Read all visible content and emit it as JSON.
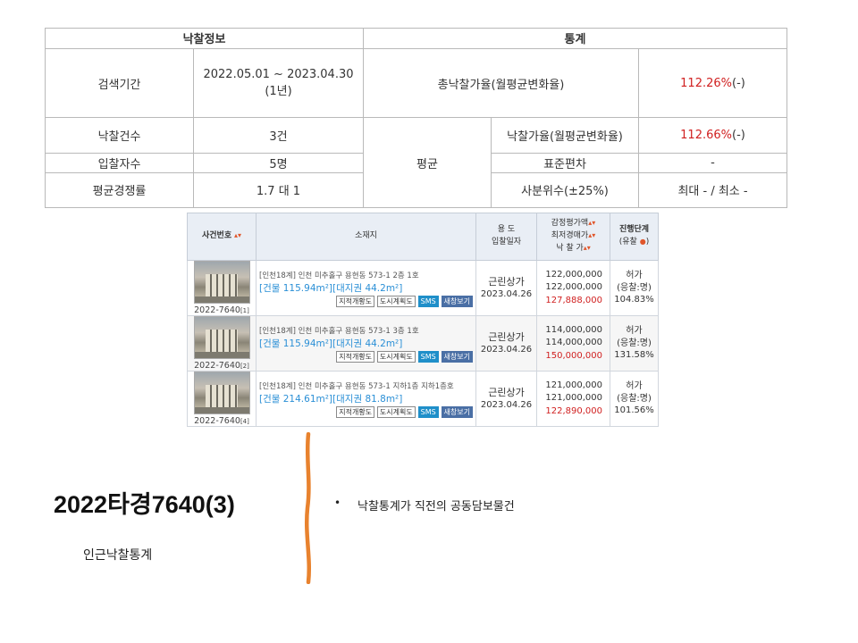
{
  "stats": {
    "header_left": "낙찰정보",
    "header_right": "통계",
    "rows": [
      {
        "label": "검색기간",
        "value": "2022.05.01 ~ 2023.04.30",
        "value_sub": "(1년)"
      },
      {
        "label": "낙찰건수",
        "value": "3건"
      },
      {
        "label": "입찰자수",
        "value": "5명"
      },
      {
        "label": "평균경쟁률",
        "value": "1.7 대 1"
      }
    ],
    "total_rate_label": "총낙찰가율(월평균변화율)",
    "total_rate_value": "112.26%",
    "total_rate_change": "(-)",
    "avg_label": "평균",
    "avg_rows": [
      {
        "label": "낙찰가율(월평균변화율)",
        "value": "112.66%",
        "change": "(-)"
      },
      {
        "label": "표준편차",
        "value": "-"
      },
      {
        "label": "사분위수(±25%)",
        "value": "최대 - / 최소 -"
      }
    ]
  },
  "auction": {
    "headers": {
      "case": "사건번호",
      "location": "소재지",
      "use_1": "용 도",
      "use_2": "입찰일자",
      "price_1": "감정평가액",
      "price_2": "최저경매가",
      "price_3": "낙 찰 가",
      "status_1": "진행단계",
      "status_2": "(유찰"
    },
    "rows": [
      {
        "case_no": "2022-7640",
        "case_idx": "[1]",
        "address": "[인천18계] 인천 미추홀구 용현동 573-1 2층 1호",
        "area": "[건물 115.94m²][대지권 44.2m²]",
        "btn1": "지적개황도",
        "btn2": "도시계획도",
        "btn3": "SMS",
        "btn4": "새창보기",
        "use": "근린상가",
        "date": "2023.04.26",
        "appraisal": "122,000,000",
        "minimum": "122,000,000",
        "sale": "127,888,000",
        "status": "허가",
        "bid": "(응찰:명)",
        "ratio": "104.83%"
      },
      {
        "case_no": "2022-7640",
        "case_idx": "[2]",
        "address": "[인천18계] 인천 미추홀구 용현동 573-1 3층 1호",
        "area": "[건물 115.94m²][대지권 44.2m²]",
        "btn1": "지적개황도",
        "btn2": "도시계획도",
        "btn3": "SMS",
        "btn4": "새창보기",
        "use": "근린상가",
        "date": "2023.04.26",
        "appraisal": "114,000,000",
        "minimum": "114,000,000",
        "sale": "150,000,000",
        "status": "허가",
        "bid": "(응찰:명)",
        "ratio": "131.58%"
      },
      {
        "case_no": "2022-7640",
        "case_idx": "[4]",
        "address": "[인천18계] 인천 미추홀구 용현동 573-1 지하1층 지하1층호",
        "area": "[건물 214.61m²][대지권 81.8m²]",
        "btn1": "지적개황도",
        "btn2": "도시계획도",
        "btn3": "SMS",
        "btn4": "새창보기",
        "use": "근린상가",
        "date": "2023.04.26",
        "appraisal": "121,000,000",
        "minimum": "121,000,000",
        "sale": "122,890,000",
        "status": "허가",
        "bid": "(응찰:명)",
        "ratio": "101.56%"
      }
    ]
  },
  "footer": {
    "title": "2022타경7640(3)",
    "subtitle": "인근낙찰통계",
    "bullet": "낙찰통계가 직전의 공동담보물건"
  },
  "colors": {
    "red": "#d01f1f",
    "divider": "#e8822e",
    "link_blue": "#2a8fd6"
  }
}
